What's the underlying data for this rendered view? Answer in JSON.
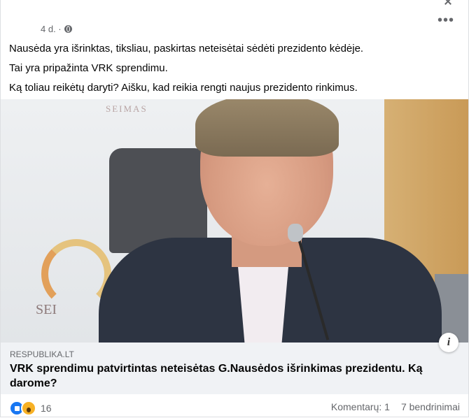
{
  "post": {
    "time": "4 d. ·",
    "more_label": "•••",
    "paragraphs": [
      "Nausėda yra išrinktas, tiksliau, paskirtas neteisėtai sėdėti prezidento kėdėje.",
      "Tai yra pripažinta VRK sprendimu.",
      "Ką toliau reikėtų daryti? Aišku, kad reikia rengti naujus prezidento rinkimus."
    ]
  },
  "photo": {
    "seimas_top": "SEIMAS",
    "seimas_bottom": "SEI"
  },
  "link": {
    "domain": "RESPUBLIKA.LT",
    "headline": "VRK sprendimu patvirtintas neteisėtas G.Nausėdos išrinkimas prezidentu. Ką darome?",
    "info_label": "i"
  },
  "footer": {
    "reaction_icons": [
      "like-icon",
      "wow-icon"
    ],
    "reaction_count": "16",
    "comments": "Komentarų: 1",
    "shares": "7 bendrinimai"
  },
  "colors": {
    "text": "#050505",
    "secondary": "#65676b",
    "link_bg": "#f0f2f5",
    "like": "#1877f2",
    "wow": "#f7b125"
  }
}
